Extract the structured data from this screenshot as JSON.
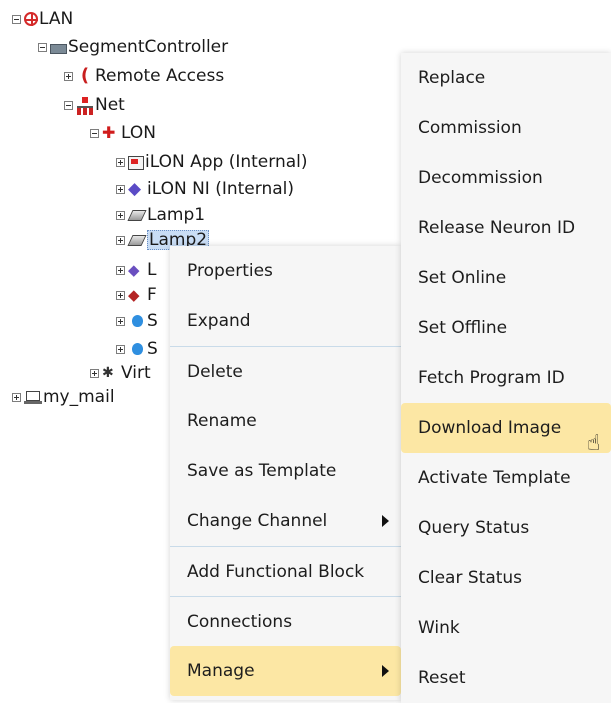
{
  "tree": {
    "nodes": [
      {
        "label": "LAN",
        "icon": "globe-icon",
        "toggle": "minus"
      },
      {
        "label": "SegmentController",
        "icon": "segment-controller-icon",
        "toggle": "minus"
      },
      {
        "label": "Remote Access",
        "icon": "remote-access-icon",
        "toggle": "plus"
      },
      {
        "label": "Net",
        "icon": "network-icon",
        "toggle": "minus"
      },
      {
        "label": "LON",
        "icon": "lon-channel-icon",
        "toggle": "minus"
      },
      {
        "label": "iLON App (Internal)",
        "icon": "app-device-icon",
        "toggle": "plus"
      },
      {
        "label": "iLON NI (Internal)",
        "icon": "ni-device-icon",
        "toggle": "plus"
      },
      {
        "label": "Lamp1",
        "icon": "lamp-device-icon",
        "toggle": "plus"
      },
      {
        "label": "Lamp2",
        "icon": "lamp-device-icon",
        "toggle": "plus",
        "selected": true,
        "visible_text": "Lamp2"
      },
      {
        "label": "L",
        "icon": "purple-device-icon",
        "toggle": "plus"
      },
      {
        "label": "F",
        "icon": "red-device-icon",
        "toggle": "plus"
      },
      {
        "label": "S",
        "icon": "blue-drop-icon",
        "toggle": "plus"
      },
      {
        "label": "S",
        "icon": "blue-drop-icon",
        "toggle": "plus"
      },
      {
        "label": "Virt",
        "icon": "virtual-device-icon",
        "toggle": "plus"
      },
      {
        "label": "my_mail",
        "icon": "laptop-icon",
        "toggle": "plus"
      }
    ]
  },
  "context_menu": {
    "items": [
      {
        "label": "Properties"
      },
      {
        "label": "Expand"
      },
      {
        "label": "Delete"
      },
      {
        "label": "Rename"
      },
      {
        "label": "Save as Template"
      },
      {
        "label": "Change Channel",
        "submenu": true
      },
      {
        "label": "Add Functional Block"
      },
      {
        "label": "Connections"
      },
      {
        "label": "Manage",
        "submenu": true,
        "highlighted": true
      }
    ]
  },
  "submenu": {
    "items": [
      {
        "label": "Replace"
      },
      {
        "label": "Commission"
      },
      {
        "label": "Decommission"
      },
      {
        "label": "Release Neuron ID"
      },
      {
        "label": "Set Online"
      },
      {
        "label": "Set Offline"
      },
      {
        "label": "Fetch Program ID"
      },
      {
        "label": "Download Image",
        "highlighted": true
      },
      {
        "label": "Activate Template"
      },
      {
        "label": "Query Status"
      },
      {
        "label": "Clear Status"
      },
      {
        "label": "Wink"
      },
      {
        "label": "Reset"
      }
    ]
  },
  "colors": {
    "highlight": "#fce7a4",
    "menu_bg": "#f6f6f6",
    "separator": "#c9dbe9",
    "selection": "#c9ddf5"
  },
  "cursor_icon": "hand-pointer-icon"
}
